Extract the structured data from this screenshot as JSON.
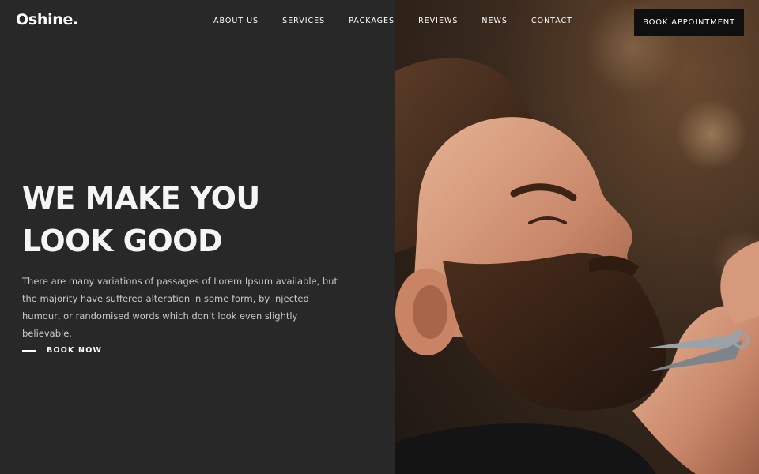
{
  "brand": {
    "logo": "Oshine."
  },
  "nav": {
    "items": [
      {
        "label": "ABOUT US"
      },
      {
        "label": "SERVICES"
      },
      {
        "label": "PACKAGES"
      },
      {
        "label": "REVIEWS"
      },
      {
        "label": "NEWS"
      },
      {
        "label": "CONTACT"
      }
    ],
    "cta_label": "BOOK APPOINTMENT"
  },
  "hero": {
    "title_line_1": "WE MAKE YOU",
    "title_line_2": "LOOK GOOD",
    "description": "There are many variations of passages of Lorem Ipsum available, but the majority have suffered alteration in some form, by injected humour, or randomised words which don't look even slightly believable.",
    "cta_label": "BOOK NOW",
    "image": "bearded-man-beard-trim-photo"
  },
  "colors": {
    "background": "#282829",
    "button_background": "#0f0f10",
    "text_primary": "#ffffff",
    "text_secondary": "#c9c9c9"
  }
}
